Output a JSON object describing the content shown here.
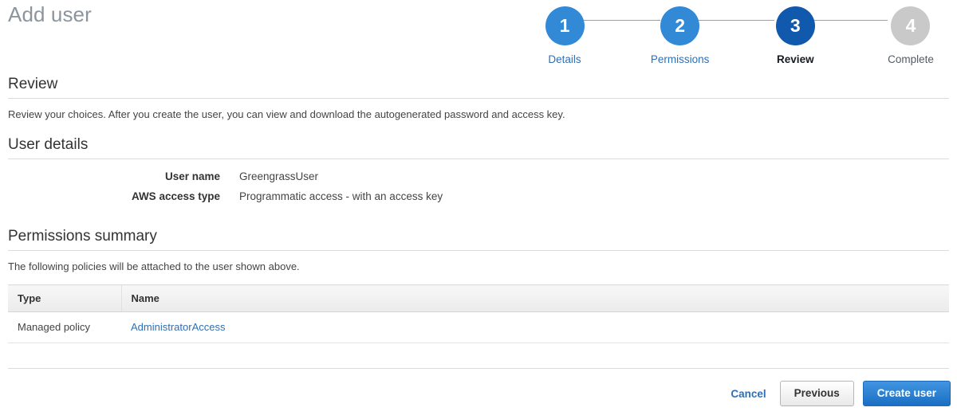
{
  "header": {
    "title": "Add user"
  },
  "stepper": {
    "steps": [
      {
        "number": "1",
        "label": "Details",
        "state": "done"
      },
      {
        "number": "2",
        "label": "Permissions",
        "state": "done"
      },
      {
        "number": "3",
        "label": "Review",
        "state": "active"
      },
      {
        "number": "4",
        "label": "Complete",
        "state": "upcoming"
      }
    ],
    "colors": {
      "done": "#3289d6",
      "active": "#1059ad",
      "upcoming": "#c9c9c9",
      "link": "#2f6fb5"
    }
  },
  "review": {
    "heading": "Review",
    "description": "Review your choices. After you create the user, you can view and download the autogenerated password and access key."
  },
  "user_details": {
    "heading": "User details",
    "rows": [
      {
        "label": "User name",
        "value": "GreengrassUser"
      },
      {
        "label": "AWS access type",
        "value": "Programmatic access - with an access key"
      }
    ]
  },
  "permissions_summary": {
    "heading": "Permissions summary",
    "description": "The following policies will be attached to the user shown above.",
    "table": {
      "columns": [
        "Type",
        "Name"
      ],
      "rows": [
        {
          "type": "Managed policy",
          "name": "AdministratorAccess"
        }
      ]
    }
  },
  "footer": {
    "cancel_label": "Cancel",
    "previous_label": "Previous",
    "create_label": "Create user"
  }
}
